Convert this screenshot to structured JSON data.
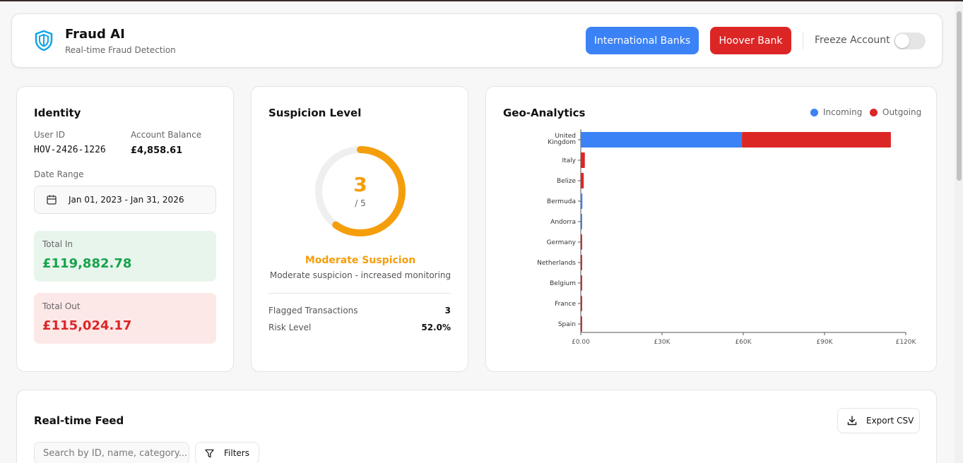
{
  "colors": {
    "accent_blue": "#3b82f6",
    "accent_red": "#dc2626",
    "warning_orange": "#f59e0b",
    "success_green": "#16a34a"
  },
  "header": {
    "logo_icon": "shield-icon",
    "title": "Fraud AI",
    "subtitle": "Real-time Fraud Detection",
    "btn_international": "International Banks",
    "btn_hoover": "Hoover Bank",
    "freeze_label": "Freeze Account",
    "freeze_on": false
  },
  "identity": {
    "title": "Identity",
    "user_id_label": "User ID",
    "user_id": "HOV-2426-1226",
    "balance_label": "Account Balance",
    "balance": "£4,858.61",
    "date_range_label": "Date Range",
    "date_range": "Jan 01, 2023 - Jan 31, 2026",
    "total_in_label": "Total In",
    "total_in": "£119,882.78",
    "total_out_label": "Total Out",
    "total_out": "£115,024.17"
  },
  "suspicion": {
    "title": "Suspicion Level",
    "score": "3",
    "score_max": "/ 5",
    "level_title": "Moderate Suspicion",
    "level_desc": "Moderate suspicion - increased monitoring",
    "flagged_label": "Flagged Transactions",
    "flagged_value": "3",
    "risk_label": "Risk Level",
    "risk_value": "52.0%",
    "gauge_fraction": 0.6
  },
  "geo": {
    "title": "Geo-Analytics",
    "legend_incoming": "Incoming",
    "legend_outgoing": "Outgoing"
  },
  "chart_data": {
    "type": "bar",
    "orientation": "horizontal",
    "stacked": true,
    "categories": [
      "United Kingdom",
      "Italy",
      "Belize",
      "Bermuda",
      "Andorra",
      "Germany",
      "Netherlands",
      "Belgium",
      "France",
      "Spain"
    ],
    "series": [
      {
        "name": "Incoming",
        "color": "#3b82f6",
        "values": [
          59500,
          0,
          0,
          600,
          400,
          0,
          0,
          0,
          0,
          0
        ]
      },
      {
        "name": "Outgoing",
        "color": "#dc2626",
        "values": [
          55000,
          1500,
          1100,
          0,
          0,
          400,
          300,
          250,
          200,
          150
        ]
      }
    ],
    "xlim": [
      0,
      120000
    ],
    "x_ticks": [
      "£0.00",
      "£30K",
      "£60K",
      "£90K",
      "£120K"
    ],
    "legend_position": "top-right",
    "grid": false
  },
  "feed": {
    "title": "Real-time Feed",
    "export_label": "Export CSV",
    "search_placeholder": "Search by ID, name, category...",
    "filters_label": "Filters"
  }
}
